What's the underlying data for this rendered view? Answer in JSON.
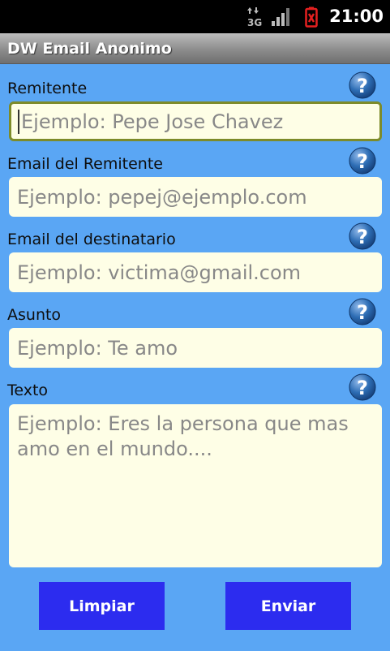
{
  "status_bar": {
    "time": "21:00",
    "network": "3G",
    "icons": [
      "3g-data-icon",
      "signal-icon",
      "battery-alert-icon"
    ]
  },
  "app": {
    "title": "DW Email Anonimo"
  },
  "form": {
    "fields": [
      {
        "label": "Remitente",
        "placeholder": "Ejemplo: Pepe Jose Chavez"
      },
      {
        "label": "Email del Remitente",
        "placeholder": "Ejemplo: pepej@ejemplo.com"
      },
      {
        "label": "Email del destinatario",
        "placeholder": "Ejemplo: victima@gmail.com"
      },
      {
        "label": "Asunto",
        "placeholder": "Ejemplo: Te amo"
      },
      {
        "label": "Texto",
        "placeholder": "Ejemplo: Eres la persona que mas amo en el mundo...."
      }
    ],
    "help_symbol": "?"
  },
  "buttons": {
    "clear": "Limpiar",
    "send": "Enviar"
  },
  "colors": {
    "background": "#5aa6f4",
    "input_bg": "#fefee6",
    "button_bg": "#2c2cef",
    "help_icon": "#2d6db4",
    "focus_border": "#7d8b2a"
  }
}
